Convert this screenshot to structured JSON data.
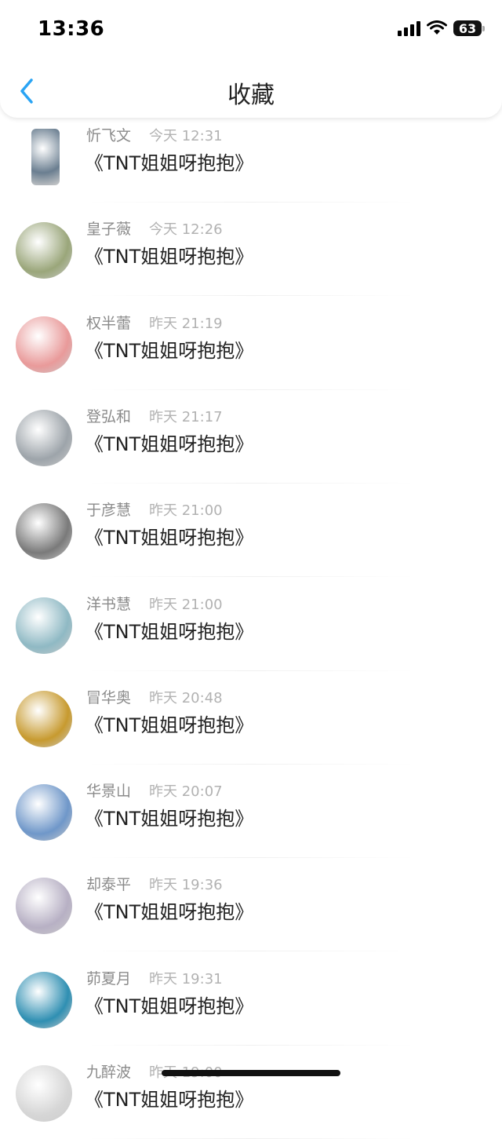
{
  "status_bar": {
    "time": "13:36",
    "battery": "63"
  },
  "header": {
    "title": "收藏"
  },
  "items": [
    {
      "name": "忻飞文",
      "time": "今天 12:31",
      "title": "《TNT姐姐呀抱抱》",
      "avatar_color": "#6a7e90"
    },
    {
      "name": "皇子薇",
      "time": "今天 12:26",
      "title": "《TNT姐姐呀抱抱》",
      "avatar_color": "#9aa67a"
    },
    {
      "name": "权半蕾",
      "time": "昨天 21:19",
      "title": "《TNT姐姐呀抱抱》",
      "avatar_color": "#e99a9a"
    },
    {
      "name": "登弘和",
      "time": "昨天 21:17",
      "title": "《TNT姐姐呀抱抱》",
      "avatar_color": "#9da4aa"
    },
    {
      "name": "于彦慧",
      "time": "昨天 21:00",
      "title": "《TNT姐姐呀抱抱》",
      "avatar_color": "#7a7a7a"
    },
    {
      "name": "洋书慧",
      "time": "昨天 21:00",
      "title": "《TNT姐姐呀抱抱》",
      "avatar_color": "#8fb9c4"
    },
    {
      "name": "冒华奥",
      "time": "昨天 20:48",
      "title": "《TNT姐姐呀抱抱》",
      "avatar_color": "#c79a2f"
    },
    {
      "name": "华景山",
      "time": "昨天 20:07",
      "title": "《TNT姐姐呀抱抱》",
      "avatar_color": "#6f97c9"
    },
    {
      "name": "却泰平",
      "time": "昨天 19:36",
      "title": "《TNT姐姐呀抱抱》",
      "avatar_color": "#b7b0c4"
    },
    {
      "name": "茆夏月",
      "time": "昨天 19:31",
      "title": "《TNT姐姐呀抱抱》",
      "avatar_color": "#2f8fb2"
    },
    {
      "name": "九醉波",
      "time": "昨天 19:00",
      "title": "《TNT姐姐呀抱抱》",
      "avatar_color": "#d6d6d6"
    }
  ]
}
